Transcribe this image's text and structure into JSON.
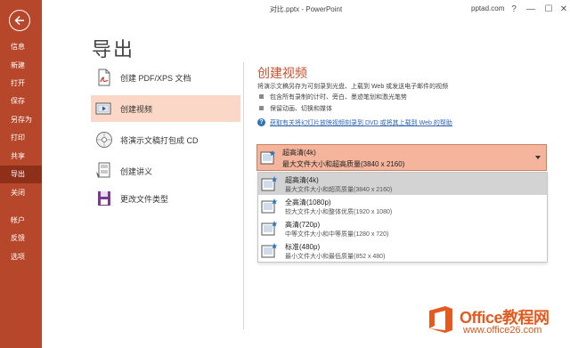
{
  "window": {
    "title": "对比.pptx  -  PowerPoint",
    "account": "pptad.com",
    "help": "?",
    "minimize": "—",
    "maximize": "☐",
    "close": "✕"
  },
  "sidebar": {
    "items": [
      {
        "label": "信息"
      },
      {
        "label": "新建"
      },
      {
        "label": "打开"
      },
      {
        "label": "保存"
      },
      {
        "label": "另存为"
      },
      {
        "label": "打印"
      },
      {
        "label": "共享"
      },
      {
        "label": "导出",
        "active": true
      },
      {
        "label": "关闭"
      },
      {
        "label": "帐户"
      },
      {
        "label": "反馈"
      },
      {
        "label": "选项"
      }
    ],
    "colors": {
      "bg": "#b7472a",
      "active": "#8e2f19"
    }
  },
  "page": {
    "title": "导出"
  },
  "menu": {
    "items": [
      {
        "label": "创建 PDF/XPS 文档",
        "icon": "pdf-document-icon"
      },
      {
        "label": "创建视频",
        "icon": "video-icon",
        "active": true
      },
      {
        "label": "将演示文稿打包成 CD",
        "icon": "cd-icon"
      },
      {
        "label": "创建讲义",
        "icon": "handout-icon"
      },
      {
        "label": "更改文件类型",
        "icon": "save-as-icon"
      }
    ]
  },
  "video": {
    "title": "创建视频",
    "description": "将演示文稿另存为可刻录到光盘、上载到 Web 或发送电子邮件的视频",
    "bullets": [
      "包含所有录制的计时、旁白、墨迹笔划和激光笔势",
      "保留动画、切换和媒体"
    ],
    "help_link": "获取有关将幻灯片放映视频刻录到 DVD 或将其上载到 Web 的帮助",
    "quality": {
      "selected_title": "超高清(4k)",
      "selected_sub": "最大文件大小和超高质量(3840 x 2160)",
      "options": [
        {
          "title": "超高清(4k)",
          "sub": "最大文件大小和超高质量(3840 x 2160)",
          "selected": true
        },
        {
          "title": "全高清(1080p)",
          "sub": "较大文件大小和整体优质(1920 x 1080)"
        },
        {
          "title": "高清(720p)",
          "sub": "中等文件大小和中等质量(1280 x 720)"
        },
        {
          "title": "标准(480p)",
          "sub": "最小文件大小和最低质量(852 x 480)"
        }
      ]
    }
  },
  "watermark": {
    "brand": "Office教程网",
    "url": "www.office26.com"
  }
}
